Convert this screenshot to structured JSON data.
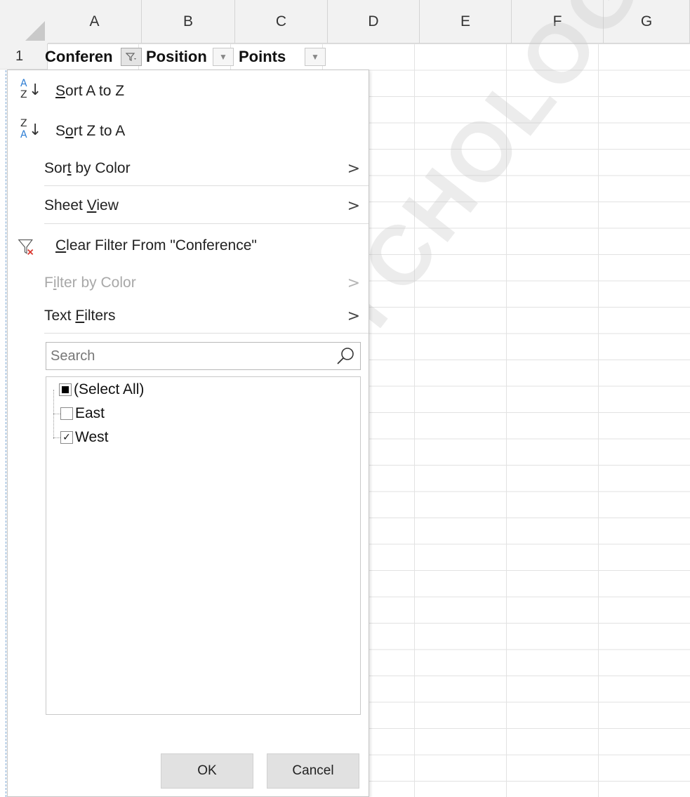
{
  "sheet": {
    "columns": [
      "A",
      "B",
      "C",
      "D",
      "E",
      "F",
      "G"
    ],
    "rows": [
      "1"
    ],
    "header_row": {
      "A": "Conferen",
      "B": "Position",
      "C": "Points"
    }
  },
  "menu": {
    "sort_az": {
      "pre": "",
      "u": "S",
      "post": "ort A to Z"
    },
    "sort_za": {
      "pre": "S",
      "u": "o",
      "post": "rt Z to A"
    },
    "sort_by_color": {
      "pre": "Sor",
      "u": "t",
      "post": " by Color"
    },
    "sheet_view": {
      "pre": "Sheet ",
      "u": "V",
      "post": "iew"
    },
    "clear_filter": {
      "pre": "",
      "u": "C",
      "post": "lear Filter From \"Conference\""
    },
    "filter_by_color": {
      "pre": "F",
      "u": "i",
      "post": "lter by Color"
    },
    "text_filters": {
      "pre": "Text ",
      "u": "F",
      "post": "ilters"
    },
    "sort_az_icon": {
      "top": "A",
      "bottom": "Z"
    },
    "sort_za_icon": {
      "top": "Z",
      "bottom": "A"
    },
    "chevron": ">"
  },
  "search": {
    "placeholder": "Search"
  },
  "filter_list": {
    "select_all": {
      "label": "(Select All)",
      "state": "mixed"
    },
    "items": [
      {
        "label": "East",
        "checked": false
      },
      {
        "label": "West",
        "checked": true
      }
    ]
  },
  "buttons": {
    "ok": "OK",
    "cancel": "Cancel"
  },
  "side_check": "✓",
  "watermark": "PSYCHOLOGY.C"
}
